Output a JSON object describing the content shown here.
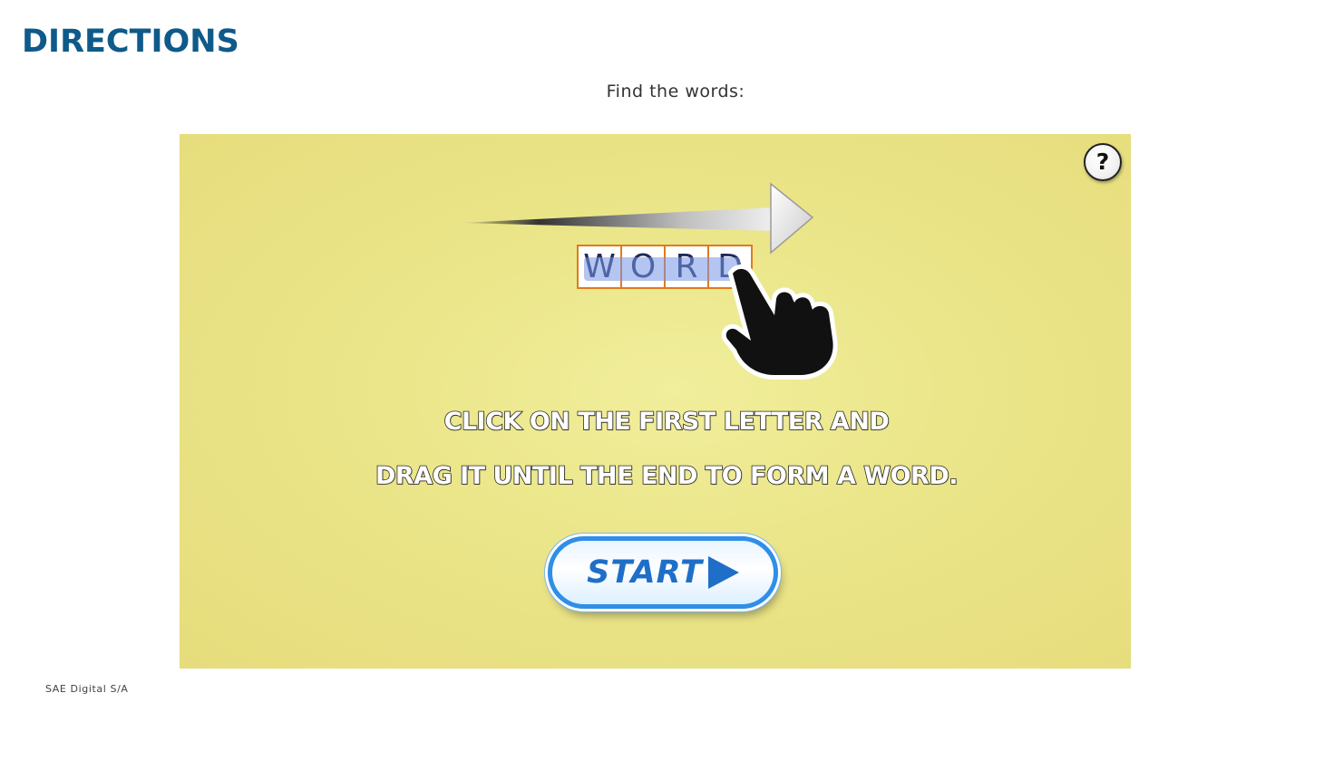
{
  "header": {
    "title": "DIRECTIONS"
  },
  "instruction": "Find the words:",
  "game": {
    "help_label": "?",
    "example_word": [
      "W",
      "O",
      "R",
      "D"
    ],
    "directions_line1": "CLICK ON THE FIRST LETTER AND",
    "directions_line2": "DRAG IT UNTIL THE END TO FORM A WORD.",
    "start_label": "START",
    "colors": {
      "background": "#ebe68a",
      "start_accent": "#1f6fc8",
      "word_border": "#e07b1a"
    }
  },
  "footer": {
    "credit": "SAE Digital S/A"
  }
}
